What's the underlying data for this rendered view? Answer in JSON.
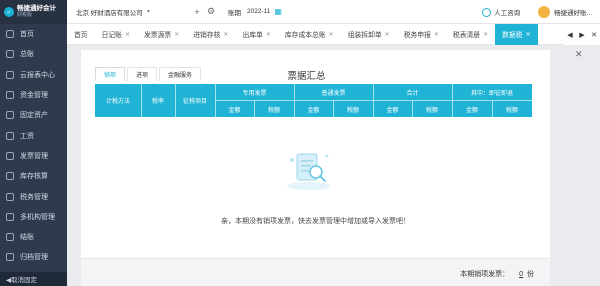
{
  "sidebar": {
    "logo_line1": "畅捷通好会计",
    "logo_line2": "财税版",
    "items": [
      {
        "label": "首页"
      },
      {
        "label": "总账"
      },
      {
        "label": "云报表中心"
      },
      {
        "label": "资金管理"
      },
      {
        "label": "固定资产"
      },
      {
        "label": "工资"
      },
      {
        "label": "发票管理"
      },
      {
        "label": "库存核算"
      },
      {
        "label": "税务管理"
      },
      {
        "label": "多机构管理"
      },
      {
        "label": "结账"
      },
      {
        "label": "归档管理"
      }
    ],
    "footer": "◀取消固定"
  },
  "topbar": {
    "company": "北京 好财酒店有限公司",
    "period_label": "账期",
    "period_value": "2022-11",
    "service_label": "人工咨询",
    "user_label": "畅捷通好账..."
  },
  "tabs": [
    {
      "label": "首页",
      "closable": false
    },
    {
      "label": "日记账",
      "closable": true
    },
    {
      "label": "发票源票",
      "closable": true
    },
    {
      "label": "进销存核",
      "closable": true
    },
    {
      "label": "出库单",
      "closable": true
    },
    {
      "label": "库存成本总账",
      "closable": true
    },
    {
      "label": "组装拆卸单",
      "closable": true
    },
    {
      "label": "税务申报",
      "closable": true
    },
    {
      "label": "税表清册",
      "closable": true
    },
    {
      "label": "数据税",
      "closable": true,
      "active": true
    }
  ],
  "panel": {
    "title": "票据汇总",
    "subtabs": [
      "销项",
      "进项",
      "金融服务"
    ],
    "table_headers": {
      "tax_method": "计税方法",
      "tax_rate": "税率",
      "tax_item": "征税项目",
      "special": "专用发票",
      "ordinary": "普通发票",
      "total": "合计",
      "including": "其中：即征即退",
      "amount": "金额",
      "tax": "税额"
    },
    "empty_message": "亲，本期没有销项发票，快去发票管理中增加或导入发票吧！",
    "summary_label": "本期销项发票：",
    "summary_value": "0",
    "summary_unit": "份"
  },
  "colors": {
    "accent": "#1fb3d6",
    "sidebar_bg": "#2e3a4d"
  }
}
